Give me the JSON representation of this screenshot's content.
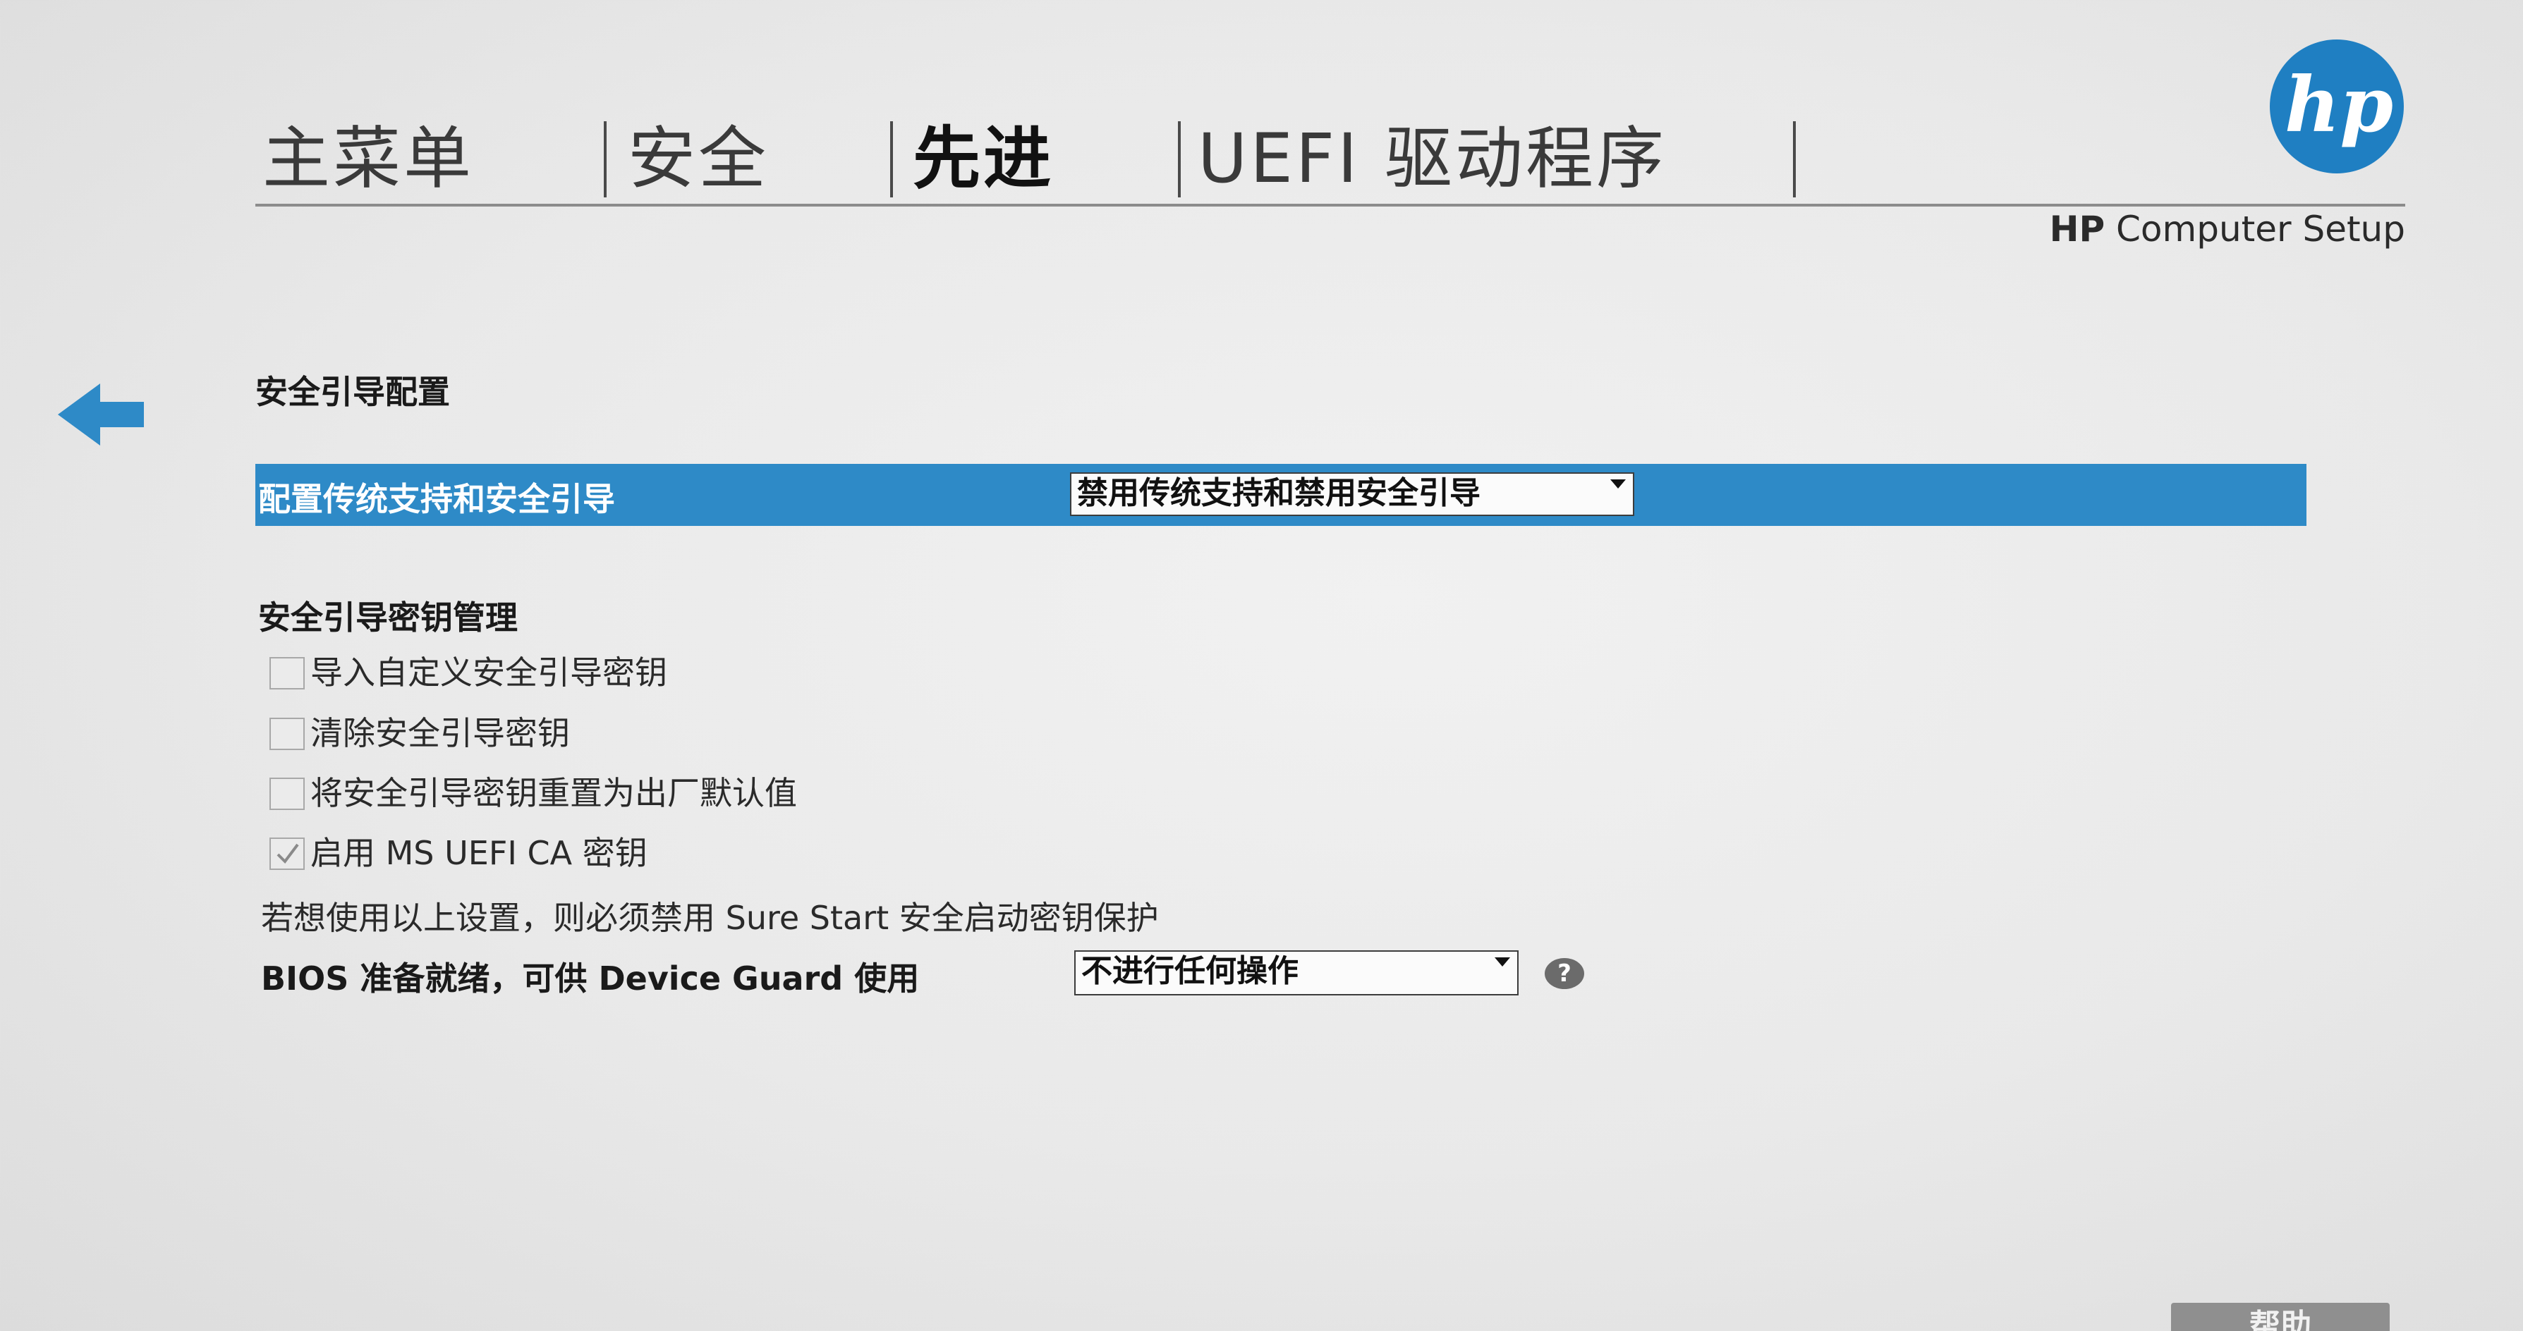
{
  "tabs": [
    {
      "label": "主菜单"
    },
    {
      "label": "安全"
    },
    {
      "label": "先进"
    },
    {
      "label": "UEFI 驱动程序"
    }
  ],
  "brand": {
    "bold": "HP",
    "rest": " Computer Setup",
    "logo_icon": "hp-logo-icon"
  },
  "back_icon": "arrow-left-icon",
  "secure_boot": {
    "section_title": "安全引导配置",
    "config_label": "配置传统支持和安全引导",
    "config_value": "禁用传统支持和禁用安全引导"
  },
  "key_management": {
    "section_title": "安全引导密钥管理",
    "items": [
      {
        "label": "导入自定义安全引导密钥",
        "checked": false
      },
      {
        "label": "清除安全引导密钥",
        "checked": false
      },
      {
        "label": "将安全引导密钥重置为出厂默认值",
        "checked": false
      },
      {
        "label": "启用 MS UEFI CA 密钥",
        "checked": true
      }
    ],
    "note": "若想使用以上设置，则必须禁用 Sure Start 安全启动密钥保护"
  },
  "device_guard": {
    "label": "BIOS 准备就绪，可供 Device Guard 使用",
    "value": "不进行任何操作",
    "help_icon": "?"
  },
  "footer": {
    "help_label": "帮助"
  },
  "colors": {
    "highlight": "#2e8ac7",
    "hp_blue": "#1f7fc2",
    "background": "#ececec"
  }
}
